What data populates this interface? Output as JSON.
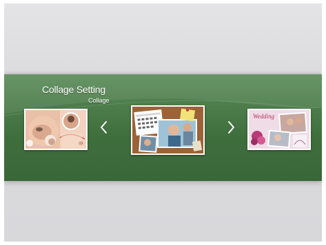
{
  "screen": {
    "title": "Collage Setting",
    "subtitle": "Collage"
  },
  "carousel": {
    "items": [
      {
        "name": "baby-collage",
        "selected": false
      },
      {
        "name": "family-calendar-collage",
        "selected": true
      },
      {
        "name": "wedding-collage",
        "selected": false,
        "caption": "Wedding"
      }
    ],
    "prev_icon": "chevron-left-icon",
    "next_icon": "chevron-right-icon"
  },
  "colors": {
    "band_top": "#5d8d5b",
    "band_bottom": "#3a6738",
    "background": "#dcdcdf",
    "text": "#ffffff"
  }
}
